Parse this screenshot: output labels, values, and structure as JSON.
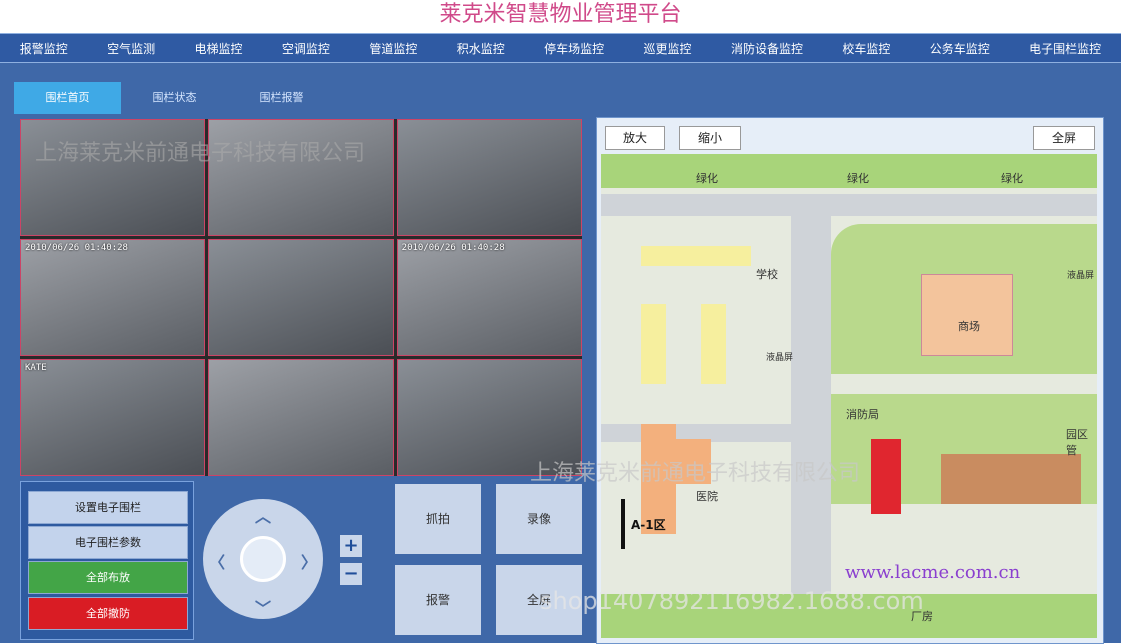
{
  "app_title": "莱克米智慧物业管理平台",
  "nav": [
    "报警监控",
    "空气监测",
    "电梯监控",
    "空调监控",
    "管道监控",
    "积水监控",
    "停车场监控",
    "巡更监控",
    "消防设备监控",
    "校车监控",
    "公务车监控",
    "电子围栏监控"
  ],
  "tabs": [
    {
      "label": "围栏首页",
      "active": true
    },
    {
      "label": "围栏状态",
      "active": false
    },
    {
      "label": "围栏报警",
      "active": false
    }
  ],
  "cameras": [
    {
      "label": ""
    },
    {
      "label": ""
    },
    {
      "label": ""
    },
    {
      "label": "2010/06/26 01:40:28"
    },
    {
      "label": ""
    },
    {
      "label": "2010/06/26 01:40:28"
    },
    {
      "label": "KATE"
    },
    {
      "label": ""
    },
    {
      "label": ""
    }
  ],
  "control_panel": {
    "set_fence": "设置电子围栏",
    "fence_params": "电子围栏参数",
    "arm_all": "全部布放",
    "disarm_all": "全部撤防"
  },
  "ptz": {
    "up": "︿",
    "down": "﹀",
    "left": "〈",
    "right": "〉",
    "zoom_in": "+",
    "zoom_out": "−"
  },
  "actions": {
    "capture": "抓拍",
    "record": "录像",
    "alarm": "报警",
    "fullscreen": "全屏"
  },
  "map_toolbar": {
    "zoom_in": "放大",
    "zoom_out": "缩小",
    "fullscreen": "全屏"
  },
  "map_labels": {
    "green1": "绿化",
    "green2": "绿化",
    "green3": "绿化",
    "school": "学校",
    "lcd1": "液晶屏",
    "lcd2": "液晶屏",
    "mall": "商场",
    "fire": "消防局",
    "park_mgmt": "园区管",
    "hospital": "医院",
    "zone": "A-1区",
    "factory": "厂房"
  },
  "watermarks": {
    "wm1": "上海莱克米前通电子科技有限公司",
    "wm2": "上海莱克米前通电子科技有限公司",
    "url": "www.lacme.com.cn",
    "shop": "shop1407892116982.1688.com"
  },
  "colors": {
    "nav_bg": "#2f5aa3",
    "main_bg": "#3f68a8",
    "tab_active": "#3fa9e6",
    "arm": "#43a547",
    "disarm": "#d91c24"
  }
}
